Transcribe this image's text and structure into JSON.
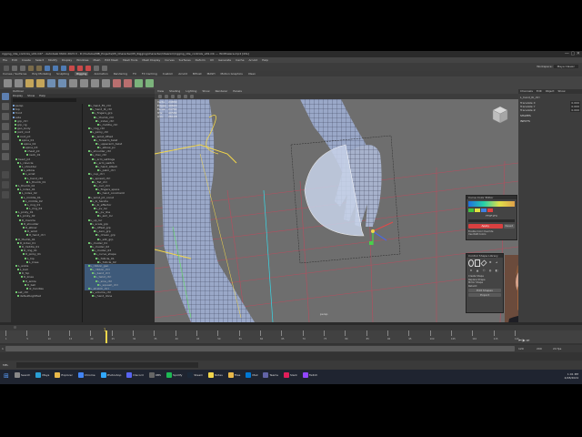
{
  "window": {
    "title": "rigging_idle_controls_v09.mb* - Autodesk MAYA 2023.3 - D:/Youtube/MB_Projects/05_Character/05_Rigging/character/idleanim/rigging_idle_controls_v09.mb --- Widthalera.mp4 [43s]"
  },
  "menu": {
    "items": [
      "File",
      "Edit",
      "Create",
      "Select",
      "Modify",
      "Display",
      "Windows",
      "Mesh",
      "Edit Mesh",
      "Mesh Tools",
      "Mesh Display",
      "Curves",
      "Surfaces",
      "Deform",
      "UV",
      "Generate",
      "Cache",
      "Arnold",
      "Help"
    ]
  },
  "status": {
    "workspace": "Workspace:",
    "workspace_value": "Maya Classic",
    "search_placeholder": ""
  },
  "shelf": {
    "tabs": [
      "Curves / Surfaces",
      "Poly Modeling",
      "Sculpting",
      "Rigging",
      "Animation",
      "Rendering",
      "FX",
      "FX Caching",
      "Custom",
      "Arnold",
      "Bifrost",
      "MASH",
      "Motion Graphics",
      "XGen"
    ]
  },
  "outliner": {
    "title": "Outliner",
    "menus": [
      "Display",
      "Show",
      "Help"
    ],
    "left_items": [
      "persp",
      "top",
      "front",
      "side",
      "grp_ctrl",
      "grp_rig",
      "geo_body",
      "joint_root",
      "root_jnt",
      "spine_01",
      "spine_02",
      "spine_03",
      "chest_jnt",
      "neck_01",
      "head_jnt",
      "L_clavicle",
      "L_shoulder",
      "L_elbow",
      "L_wrist",
      "L_hand_ctrl",
      "L_thumb_01",
      "L_thumb_02",
      "L_index_01",
      "L_index_02",
      "L_middle_01",
      "L_middle_02",
      "L_ring_01",
      "L_ring_02",
      "L_pinky_01",
      "L_pinky_02",
      "R_clavicle",
      "R_shoulder",
      "R_elbow",
      "R_wrist",
      "R_hand_ctrl",
      "R_thumb_01",
      "R_index_01",
      "R_middle_01",
      "R_ring_01",
      "R_pinky_01",
      "L_hip",
      "L_knee",
      "L_ankle",
      "L_ball",
      "R_hip",
      "R_knee",
      "R_ankle",
      "R_ball",
      "ik_handles",
      "set_ctrl",
      "defaultLightSet"
    ],
    "right_items": [
      "L_hand_FK_ctrl",
      "L_hand_IK_ctrl",
      "L_fingers_grp",
      "L_thumb_ctrl",
      "L_index_ctrl",
      "L_middle_ctrl",
      "L_ring_ctrl",
      "L_pinky_ctrl",
      "L_wrist_offset",
      "L_forearm_twist",
      "L_upperarm_twist",
      "L_elbow_pv",
      "L_shoulder_ctrl",
      "L_clav_ctrl",
      "L_arm_settings",
      "L_arm_switch",
      "L_hand_attach",
      "L_palm_ctrl",
      "L_cup_ctrl",
      "L_spread_ctrl",
      "L_fist_ctrl",
      "L_curl_ctrl",
      "L_fingers_space",
      "L_hand_constraint",
      "L_wrist_jnt_const",
      "L_ik_handle",
      "L_ik_effector",
      "L_pv_loc",
      "L_pv_line",
      "L_aim_loc",
      "L_up_loc",
      "L_scale_grp",
      "L_offset_grp",
      "L_zero_grp",
      "L_driven_grp",
      "L_sdk_grp",
      "L_cluster_01",
      "L_cluster_02",
      "L_cluster_03",
      "L_curve_shape",
      "L_follicle_01",
      "L_follicle_02",
      "L_ribbon_geo",
      "L_ribbon_ctrl",
      "L_bend_ctrl",
      "L_twist_ctrl",
      "L_sine_ctrl",
      "L_squash_ctrl",
      "L_stretch_ctrl",
      "L_volume_ctrl",
      "L_hand_done"
    ]
  },
  "viewport": {
    "menus": [
      "View",
      "Shading",
      "Lighting",
      "Show",
      "Renderer",
      "Panels"
    ],
    "camera_label": "persp",
    "hud_rows": [
      [
        "Verts:",
        "24830"
      ],
      [
        "Edges:",
        "49620"
      ],
      [
        "Faces:",
        "24792"
      ],
      [
        "Tris:",
        "49584"
      ],
      [
        "UVs:",
        "26118"
      ]
    ]
  },
  "channel_box": {
    "tabs": [
      "Channels",
      "Edit",
      "Object",
      "Show"
    ],
    "object_name": "L_hand_IK_ctrl",
    "attrs": [
      [
        "Translate X",
        "0.000"
      ],
      [
        "Translate Y",
        "0.000"
      ],
      [
        "Translate Z",
        "0.000"
      ]
    ],
    "section": "SHAPES",
    "section2": "INPUTS"
  },
  "color_popup": {
    "title": "Curve Color Editor",
    "hex_label": "FF0F1F0",
    "apply_label": "Apply",
    "reset_label": "Reset",
    "text1": "Enable Color Override",
    "text2": "Use RGB Colors"
  },
  "shapes_popup": {
    "title": "Control Shape Library",
    "rows": [
      "Create Shape",
      "Replace Shape",
      "Mirror Shape",
      "Rebuild"
    ],
    "btn1": "Edit Shapes",
    "btn2": "Export"
  },
  "timeline": {
    "ticks": [
      "1",
      "5",
      "10",
      "15",
      "20",
      "25",
      "30",
      "35",
      "40",
      "45",
      "50",
      "55",
      "60",
      "65",
      "70",
      "75",
      "80",
      "85",
      "90",
      "95",
      "100",
      "105",
      "110",
      "115",
      "120"
    ],
    "start": "1",
    "end": "120",
    "current": "1",
    "range_end": "200",
    "fps": "24 fps"
  },
  "cmdline": {
    "label": "MEL",
    "text": ""
  },
  "taskbar": {
    "apps": [
      "Search",
      "Maya",
      "Explorer",
      "Chrome",
      "Photoshop",
      "Discord",
      "OBS",
      "Spotify",
      "Steam",
      "Notes",
      "Files",
      "Mail",
      "Teams",
      "Slack",
      "Twitch"
    ],
    "time": "1:01 PM",
    "date": "4/28/2024"
  },
  "colors": {
    "viewport": "#6e6e6e",
    "grid": "#c8455a",
    "mesh": "#9aa8c8",
    "accent": "#f2d64b"
  }
}
